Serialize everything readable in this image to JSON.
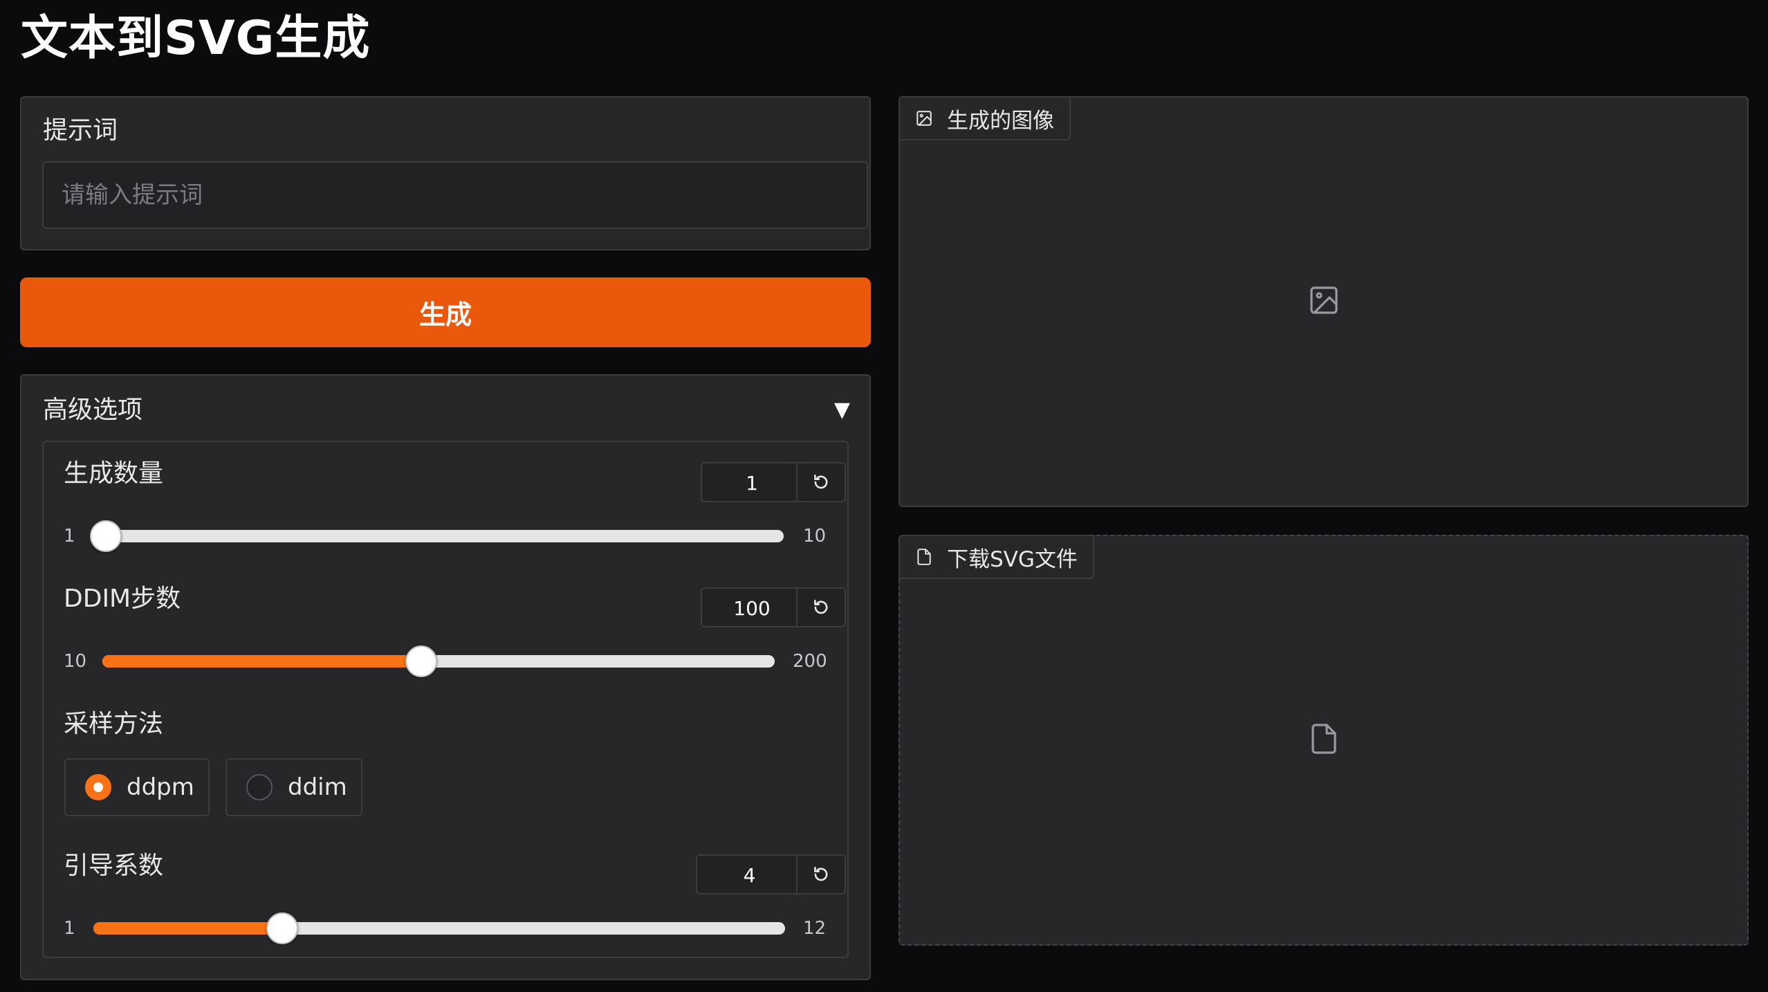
{
  "app": {
    "title": "文本到SVG生成"
  },
  "prompt": {
    "label": "提示词",
    "placeholder": "请输入提示词",
    "value": ""
  },
  "generate_button": {
    "label": "生成"
  },
  "advanced": {
    "label": "高级选项",
    "expanded": true,
    "toggle_glyph": "▼",
    "num_samples": {
      "label": "生成数量",
      "value": "1",
      "min": "1",
      "max": "10",
      "fraction": 0.0
    },
    "ddim_steps": {
      "label": "DDIM步数",
      "value": "100",
      "min": "10",
      "max": "200",
      "fraction": 0.474
    },
    "sampler": {
      "label": "采样方法",
      "options": [
        "ddpm",
        "ddim"
      ],
      "selected": "ddpm"
    },
    "guidance_scale": {
      "label": "引导系数",
      "value": "4",
      "min": "1",
      "max": "12",
      "fraction": 0.273
    }
  },
  "outputs": {
    "image": {
      "label": "生成的图像",
      "icon": "image-icon"
    },
    "file": {
      "label": "下载SVG文件",
      "icon": "file-icon"
    }
  },
  "colors": {
    "accent": "#ea580c",
    "slider_fill": "#f97316",
    "background": "#0b0b0d",
    "panel": "#27272a"
  }
}
